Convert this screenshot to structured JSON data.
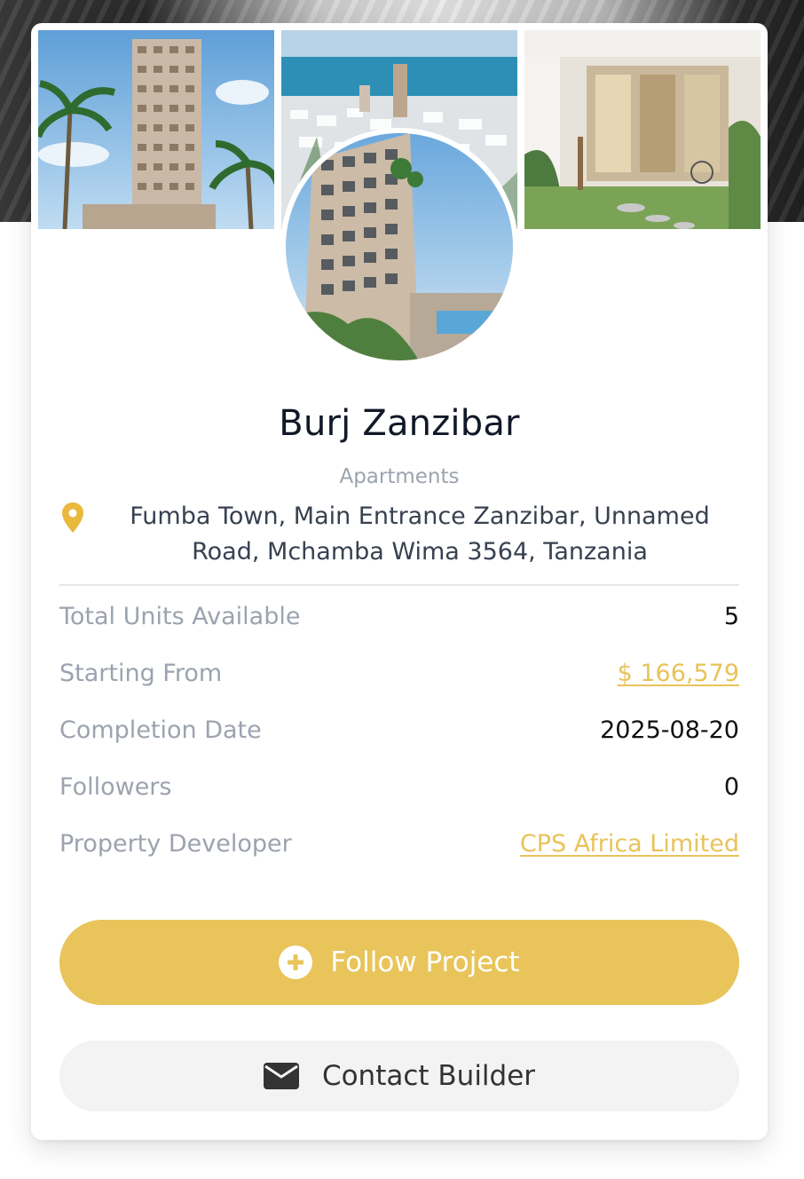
{
  "project": {
    "name": "Burj Zanzibar",
    "category": "Apartments",
    "address": "Fumba Town, Main Entrance Zanzibar, Unnamed Road, Mchamba Wima 3564, Tanzania"
  },
  "details": [
    {
      "label": "Total Units Available",
      "value": "5",
      "link": false
    },
    {
      "label": "Starting From",
      "value": "$ 166,579",
      "link": true
    },
    {
      "label": "Completion Date",
      "value": "2025-08-20",
      "link": false
    },
    {
      "label": "Followers",
      "value": "0",
      "link": false
    },
    {
      "label": "Property Developer",
      "value": "CPS Africa Limited",
      "link": true
    }
  ],
  "actions": {
    "follow_label": "Follow Project",
    "contact_label": "Contact Builder"
  },
  "icons": {
    "location": "map-pin-icon",
    "follow": "plus-circle-icon",
    "contact": "envelope-icon"
  },
  "colors": {
    "accent": "#e8c45a",
    "link": "#e8c35a",
    "muted": "#9ca3af",
    "title": "#111827"
  }
}
